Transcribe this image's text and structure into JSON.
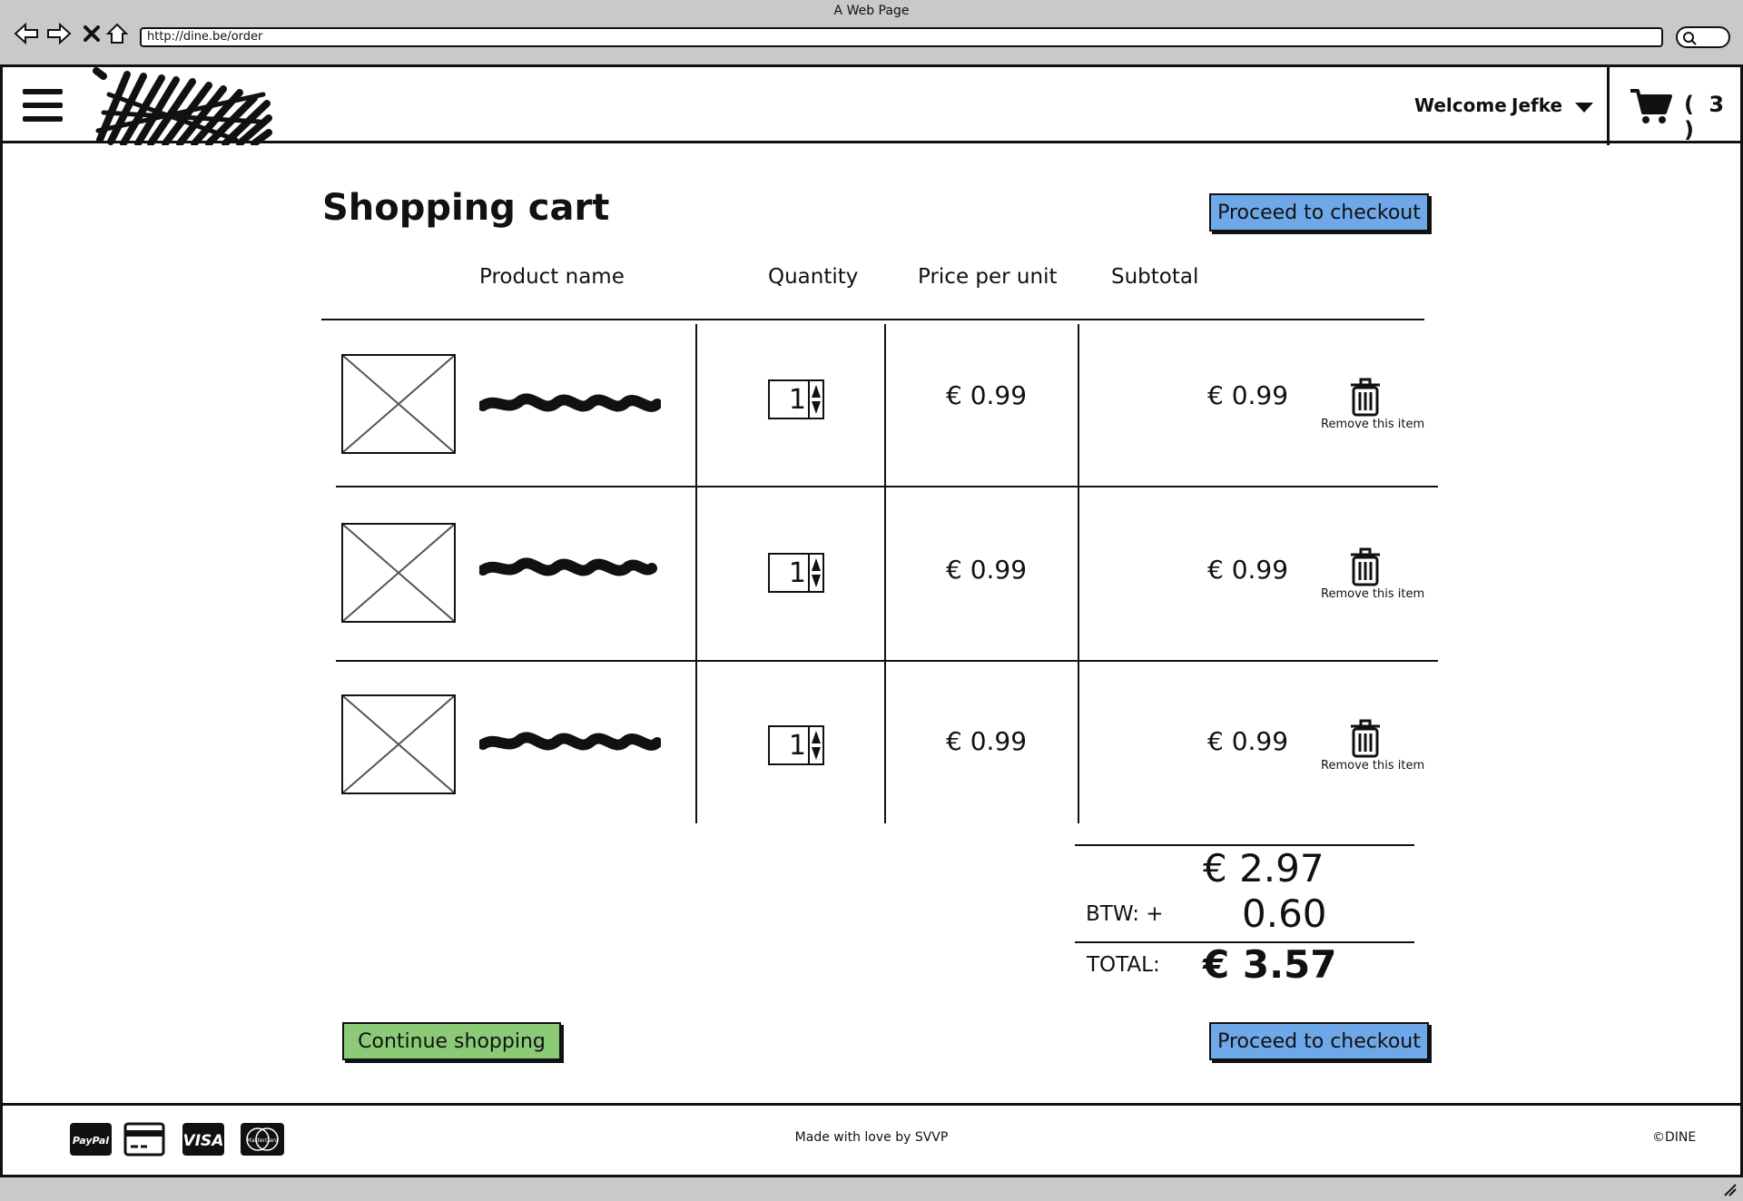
{
  "browser": {
    "window_title": "A Web Page",
    "url": "http://dine.be/order"
  },
  "header": {
    "welcome": "Welcome",
    "username": "Jefke",
    "cart_count": "( 3 )"
  },
  "page": {
    "title": "Shopping cart",
    "checkout_label": "Proceed to checkout",
    "continue_label": "Continue shopping"
  },
  "table": {
    "columns": [
      "Product name",
      "Quantity",
      "Price per unit",
      "Subtotal"
    ],
    "rows": [
      {
        "quantity": "1",
        "price": "€ 0.99",
        "subtotal": "€ 0.99",
        "remove": "Remove this item"
      },
      {
        "quantity": "1",
        "price": "€ 0.99",
        "subtotal": "€ 0.99",
        "remove": "Remove this item"
      },
      {
        "quantity": "1",
        "price": "€ 0.99",
        "subtotal": "€ 0.99",
        "remove": "Remove this item"
      }
    ]
  },
  "totals": {
    "sum": "€ 2.97",
    "btw_label": "BTW:  +",
    "btw_value": "0.60",
    "total_label": "TOTAL:",
    "total_value": "€ 3.57"
  },
  "footer": {
    "made_with": "Made with love by SVVP",
    "copyright": "©DINE",
    "payment_icons": [
      "paypal-icon",
      "credit-card-icon",
      "visa-icon",
      "mastercard-icon"
    ],
    "paypal_text": "PayPal",
    "visa_text": "VISA",
    "mastercard_text": "MasterCard"
  },
  "colors": {
    "checkout_button": "#6fa8e8",
    "continue_button": "#8bca76",
    "chrome": "#c9c9c9"
  }
}
